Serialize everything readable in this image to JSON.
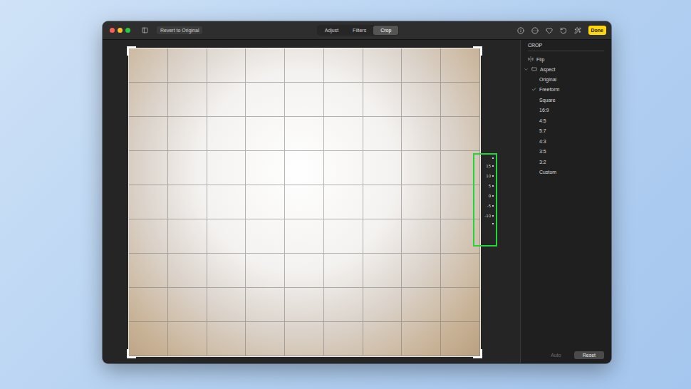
{
  "toolbar": {
    "revert": "Revert to Original",
    "tabs": [
      {
        "label": "Adjust",
        "selected": false
      },
      {
        "label": "Filters",
        "selected": false
      },
      {
        "label": "Crop",
        "selected": true
      }
    ],
    "done": "Done"
  },
  "sidebar": {
    "title": "CROP",
    "flip": "Flip",
    "aspect": {
      "label": "Aspect",
      "expanded": true,
      "options": [
        {
          "label": "Original",
          "selected": false
        },
        {
          "label": "Freeform",
          "selected": true
        },
        {
          "label": "Square",
          "selected": false
        },
        {
          "label": "16:9",
          "selected": false
        },
        {
          "label": "4:5",
          "selected": false
        },
        {
          "label": "5:7",
          "selected": false
        },
        {
          "label": "4:3",
          "selected": false
        },
        {
          "label": "3:5",
          "selected": false
        },
        {
          "label": "3:2",
          "selected": false
        },
        {
          "label": "Custom",
          "selected": false
        }
      ]
    }
  },
  "dial": {
    "labels": [
      "15",
      "10",
      "5",
      "0",
      "-5",
      "-10"
    ],
    "highlighted": true
  },
  "footer": {
    "buttons": [
      {
        "label": "Auto",
        "disabled": true
      },
      {
        "label": "Reset",
        "disabled": false
      }
    ]
  }
}
